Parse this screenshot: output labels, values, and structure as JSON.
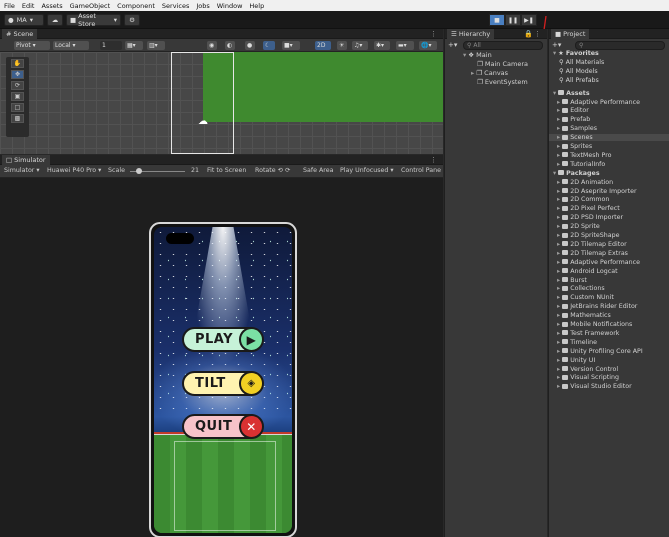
{
  "menubar": [
    "File",
    "Edit",
    "Assets",
    "GameObject",
    "Component",
    "Services",
    "Jobs",
    "Window",
    "Help"
  ],
  "toolbar": {
    "account": "MA",
    "asset_store": "Asset Store"
  },
  "scene": {
    "tab": "Scene",
    "pivot": "Pivot",
    "local": "Local",
    "grid_value": "1",
    "mode_2d": "2D"
  },
  "simulator": {
    "tab": "Simulator",
    "mode": "Simulator",
    "device": "Huawei P40 Pro",
    "scale_label": "Scale",
    "scale_value": "21",
    "fit": "Fit to Screen",
    "rotate": "Rotate",
    "safe_area": "Safe Area",
    "play_mode": "Play Unfocused",
    "control": "Control Pane",
    "buttons": [
      {
        "label": "PLAY",
        "color": "#c6f2d8"
      },
      {
        "label": "TILT",
        "color": "#fff3b0"
      },
      {
        "label": "QUIT",
        "color": "#f7c3c9"
      }
    ]
  },
  "hierarchy": {
    "tab": "Hierarchy",
    "search_placeholder": "All",
    "scene": "Main",
    "children": [
      "Main Camera",
      "Canvas",
      "EventSystem"
    ]
  },
  "project": {
    "tab": "Project",
    "favorites_label": "Favorites",
    "favorites": [
      "All Materials",
      "All Models",
      "All Prefabs"
    ],
    "assets_label": "Assets",
    "assets": [
      "Adaptive Performance",
      "Editor",
      "Prefab",
      "Samples",
      "Scenes",
      "Sprites",
      "TextMesh Pro",
      "TutorialInfo"
    ],
    "selected_asset": "Scenes",
    "packages_label": "Packages",
    "packages": [
      "2D Animation",
      "2D Aseprite Importer",
      "2D Common",
      "2D Pixel Perfect",
      "2D PSD Importer",
      "2D Sprite",
      "2D SpriteShape",
      "2D Tilemap Editor",
      "2D Tilemap Extras",
      "Adaptive Performance",
      "Android Logcat",
      "Burst",
      "Collections",
      "Custom NUnit",
      "JetBrains Rider Editor",
      "Mathematics",
      "Mobile Notifications",
      "Test Framework",
      "Timeline",
      "Unity Profiling Core API",
      "Unity UI",
      "Version Control",
      "Visual Scripting",
      "Visual Studio Editor"
    ]
  }
}
